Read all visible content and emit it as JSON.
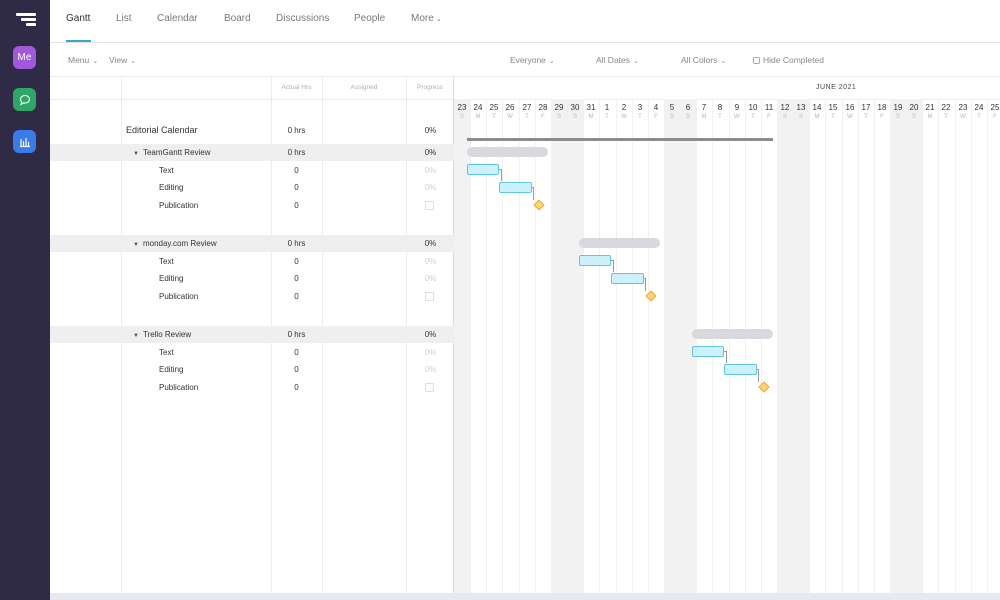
{
  "tabs": [
    {
      "label": "Gantt",
      "active": true
    },
    {
      "label": "List"
    },
    {
      "label": "Calendar"
    },
    {
      "label": "Board"
    },
    {
      "label": "Discussions"
    },
    {
      "label": "People"
    },
    {
      "label": "More"
    }
  ],
  "rail": {
    "me_label": "Me"
  },
  "toolbar": {
    "menu": "Menu",
    "view": "View",
    "everyone": "Everyone",
    "all_dates": "All Dates",
    "all_colors": "All Colors",
    "hide_completed": "Hide Completed"
  },
  "columns": {
    "actual_hrs": "Actual Hrs",
    "assigned": "Assigned",
    "progress": "Progress"
  },
  "project": {
    "name": "Editorial Calendar",
    "hours": "0 hrs",
    "progress": "0%"
  },
  "groups": [
    {
      "name": "TeamGantt Review",
      "hours": "0 hrs",
      "progress": "0%",
      "tasks": [
        {
          "name": "Text",
          "hours": "0",
          "progress": "0%"
        },
        {
          "name": "Editing",
          "hours": "0",
          "progress": "0%"
        },
        {
          "name": "Publication",
          "hours": "0",
          "milestone": true
        }
      ]
    },
    {
      "name": "monday.com Review",
      "hours": "0 hrs",
      "progress": "0%",
      "tasks": [
        {
          "name": "Text",
          "hours": "0",
          "progress": "0%"
        },
        {
          "name": "Editing",
          "hours": "0",
          "progress": "0%"
        },
        {
          "name": "Publication",
          "hours": "0",
          "milestone": true
        }
      ]
    },
    {
      "name": "Trello Review",
      "hours": "0 hrs",
      "progress": "0%",
      "tasks": [
        {
          "name": "Text",
          "hours": "0",
          "progress": "0%"
        },
        {
          "name": "Editing",
          "hours": "0",
          "progress": "0%"
        },
        {
          "name": "Publication",
          "hours": "0",
          "milestone": true
        }
      ]
    }
  ],
  "timeline": {
    "month_label": "JUNE 2021",
    "days": [
      {
        "n": "23",
        "d": "S"
      },
      {
        "n": "24",
        "d": "M"
      },
      {
        "n": "25",
        "d": "T"
      },
      {
        "n": "26",
        "d": "W"
      },
      {
        "n": "27",
        "d": "T"
      },
      {
        "n": "28",
        "d": "F"
      },
      {
        "n": "29",
        "d": "S"
      },
      {
        "n": "30",
        "d": "S"
      },
      {
        "n": "31",
        "d": "M"
      },
      {
        "n": "1",
        "d": "T"
      },
      {
        "n": "2",
        "d": "W"
      },
      {
        "n": "3",
        "d": "T"
      },
      {
        "n": "4",
        "d": "F"
      },
      {
        "n": "5",
        "d": "S"
      },
      {
        "n": "6",
        "d": "S"
      },
      {
        "n": "7",
        "d": "M"
      },
      {
        "n": "8",
        "d": "T"
      },
      {
        "n": "9",
        "d": "W"
      },
      {
        "n": "10",
        "d": "T"
      },
      {
        "n": "11",
        "d": "F"
      },
      {
        "n": "12",
        "d": "S"
      },
      {
        "n": "13",
        "d": "S"
      },
      {
        "n": "14",
        "d": "M"
      },
      {
        "n": "15",
        "d": "T"
      },
      {
        "n": "16",
        "d": "W"
      },
      {
        "n": "17",
        "d": "T"
      },
      {
        "n": "18",
        "d": "F"
      },
      {
        "n": "19",
        "d": "S"
      },
      {
        "n": "20",
        "d": "S"
      },
      {
        "n": "21",
        "d": "M"
      },
      {
        "n": "22",
        "d": "T"
      },
      {
        "n": "23",
        "d": "W"
      },
      {
        "n": "24",
        "d": "T"
      },
      {
        "n": "25",
        "d": "F"
      }
    ]
  }
}
